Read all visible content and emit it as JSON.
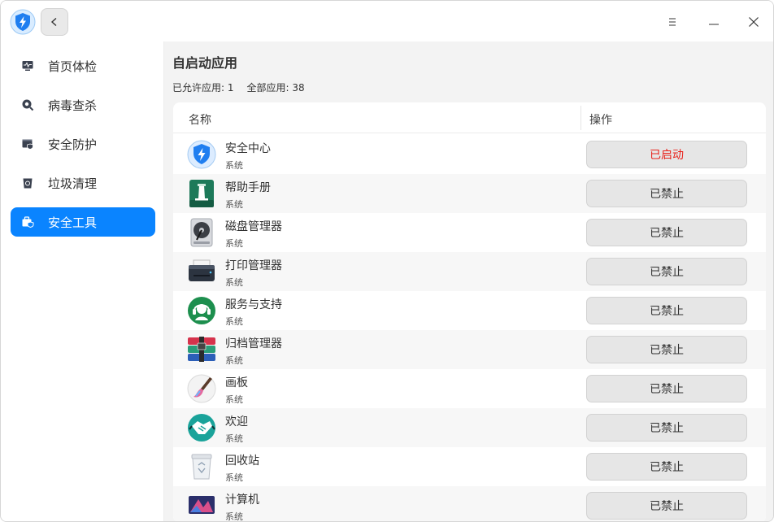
{
  "titlebar": {
    "logo_icon": "shield-bolt-icon",
    "back_icon": "chevron-left-icon",
    "menu_icon": "menu-icon",
    "minimize_icon": "minimize-icon",
    "close_icon": "close-icon"
  },
  "sidebar": {
    "items": [
      {
        "label": "首页体检",
        "icon": "monitor-pulse-icon",
        "active": false
      },
      {
        "label": "病毒查杀",
        "icon": "virus-scan-icon",
        "active": false
      },
      {
        "label": "安全防护",
        "icon": "shield-window-icon",
        "active": false
      },
      {
        "label": "垃圾清理",
        "icon": "trash-clean-icon",
        "active": false
      },
      {
        "label": "安全工具",
        "icon": "toolbox-icon",
        "active": true
      }
    ],
    "accent": "#0a84ff"
  },
  "main": {
    "title": "自启动应用",
    "allowed_label": "已允许应用: 1",
    "total_label": "全部应用: 38",
    "columns": {
      "name": "名称",
      "action": "操作"
    },
    "rows": [
      {
        "name": "安全中心",
        "type": "系统",
        "action": "已启动",
        "enabled": true,
        "icon": "security-center-icon"
      },
      {
        "name": "帮助手册",
        "type": "系统",
        "action": "已禁止",
        "enabled": false,
        "icon": "help-manual-icon"
      },
      {
        "name": "磁盘管理器",
        "type": "系统",
        "action": "已禁止",
        "enabled": false,
        "icon": "disk-manager-icon"
      },
      {
        "name": "打印管理器",
        "type": "系统",
        "action": "已禁止",
        "enabled": false,
        "icon": "printer-icon"
      },
      {
        "name": "服务与支持",
        "type": "系统",
        "action": "已禁止",
        "enabled": false,
        "icon": "support-headset-icon"
      },
      {
        "name": "归档管理器",
        "type": "系统",
        "action": "已禁止",
        "enabled": false,
        "icon": "archive-manager-icon"
      },
      {
        "name": "画板",
        "type": "系统",
        "action": "已禁止",
        "enabled": false,
        "icon": "paint-brush-icon"
      },
      {
        "name": "欢迎",
        "type": "系统",
        "action": "已禁止",
        "enabled": false,
        "icon": "welcome-handshake-icon"
      },
      {
        "name": "回收站",
        "type": "系统",
        "action": "已禁止",
        "enabled": false,
        "icon": "recycle-bin-icon"
      },
      {
        "name": "计算机",
        "type": "系统",
        "action": "已禁止",
        "enabled": false,
        "icon": "computer-icon"
      }
    ],
    "enabled_color": "#e8211a"
  }
}
